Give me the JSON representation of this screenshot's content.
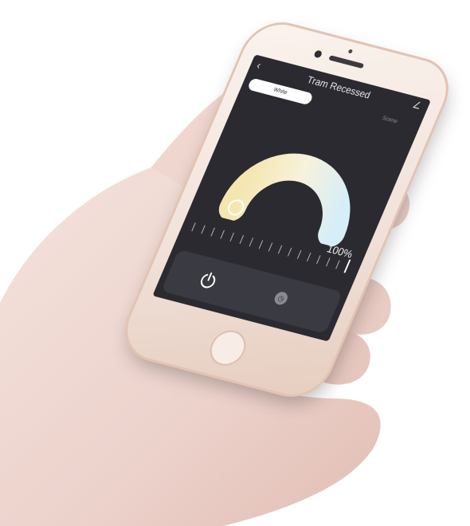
{
  "app": {
    "title": "Tram Recessed",
    "tabs": [
      {
        "label": "White",
        "active": true
      },
      {
        "label": "Scene",
        "active": false
      }
    ],
    "brightness_label": "100%",
    "brightness_value": 1.0,
    "icons": {
      "back": "back-arrow-icon",
      "edit": "edit-icon",
      "power": "power-icon",
      "timer": "timer-icon"
    },
    "colors": {
      "screen_bg": "#2a2a30",
      "dial_warm": "#f3e7b8",
      "dial_cool": "#d9eef6"
    }
  }
}
